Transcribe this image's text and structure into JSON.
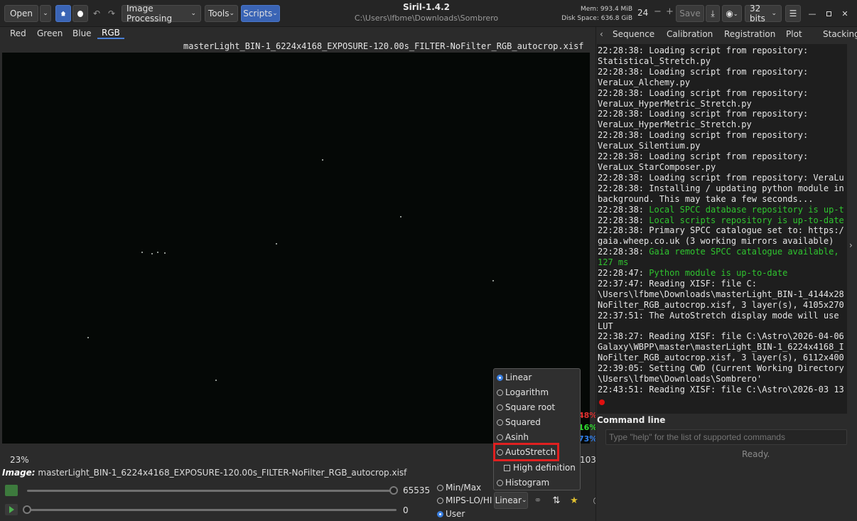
{
  "header": {
    "open_label": "Open",
    "image_processing_label": "Image Processing",
    "tools_label": "Tools",
    "scripts_label": "Scripts",
    "app_title": "Siril-1.4.2",
    "cwd": "C:\\Users\\lfbme\\Downloads\\Sombrero",
    "mem": "Mem: 993.4 MiB",
    "disk": "Disk Space: 636.8 GiB",
    "cpu_count": "24",
    "save_label": "Save",
    "bits_label": "32 bits"
  },
  "channels": [
    "Red",
    "Green",
    "Blue",
    "RGB"
  ],
  "filename_top": "masterLight_BIN-1_6224x4168_EXPOSURE-120.00s_FILTER-NoFilter_RGB_autocrop.xisf",
  "zoom": "23%",
  "pct_red": "48%",
  "pct_green": "16%",
  "pct_blue": "73%",
  "partial_103": "103",
  "image_label": "Image:",
  "image_name": "masterLight_BIN-1_6224x4168_EXPOSURE-120.00s_FILTER-NoFilter_RGB_autocrop.xisf",
  "slider_high": "65535",
  "slider_low": "0",
  "scale_modes": [
    "Min/Max",
    "MIPS-LO/HI",
    "User"
  ],
  "display_mode_button": "Linear",
  "display_menu": {
    "items": [
      "Linear",
      "Logarithm",
      "Square root",
      "Squared",
      "Asinh",
      "AutoStretch"
    ],
    "high_def": "High definition",
    "histogram": "Histogram"
  },
  "right_tabs": [
    "Sequence",
    "Calibration",
    "Registration",
    "Plot",
    "Stacking"
  ],
  "log_lines": [
    {
      "t": "22:28:38: Loading script from repository:",
      "c": ""
    },
    {
      "t": "Statistical_Stretch.py",
      "c": ""
    },
    {
      "t": "22:28:38: Loading script from repository:",
      "c": ""
    },
    {
      "t": "VeraLux_Alchemy.py",
      "c": ""
    },
    {
      "t": "22:28:38: Loading script from repository:",
      "c": ""
    },
    {
      "t": "VeraLux_HyperMetric_Stretch.py",
      "c": ""
    },
    {
      "t": "22:28:38: Loading script from repository:",
      "c": ""
    },
    {
      "t": "VeraLux_HyperMetric_Stretch.py",
      "c": ""
    },
    {
      "t": "22:28:38: Loading script from repository:",
      "c": ""
    },
    {
      "t": "VeraLux_Silentium.py",
      "c": ""
    },
    {
      "t": "22:28:38: Loading script from repository:",
      "c": ""
    },
    {
      "t": "VeraLux_StarComposer.py",
      "c": ""
    },
    {
      "t": "22:28:38: Loading script from repository: VeraLu",
      "c": ""
    },
    {
      "t": "22:28:38: Installing / updating python module in",
      "c": ""
    },
    {
      "t": "background. This may take a few seconds...",
      "c": ""
    },
    {
      "t": "22:28:38: ",
      "c": "",
      "g": "Local SPCC database repository is up-t"
    },
    {
      "t": "22:28:38: ",
      "c": "",
      "g": "Local scripts repository is up-to-date"
    },
    {
      "t": "22:28:38: Primary SPCC catalogue set to: https:/",
      "c": ""
    },
    {
      "t": "gaia.wheep.co.uk (3 working mirrors available)",
      "c": ""
    },
    {
      "t": "22:28:38: ",
      "c": "",
      "g": "Gaia remote SPCC catalogue available,"
    },
    {
      "t": "",
      "c": "",
      "g": "127 ms"
    },
    {
      "t": "22:28:47: ",
      "c": "",
      "g": "Python module is up-to-date"
    },
    {
      "t": "22:37:47: Reading XISF: file C:",
      "c": ""
    },
    {
      "t": "\\Users\\lfbme\\Downloads\\masterLight_BIN-1_4144x28",
      "c": ""
    },
    {
      "t": "NoFilter_RGB_autocrop.xisf, 3 layer(s), 4105x270",
      "c": ""
    },
    {
      "t": "22:37:51: The AutoStretch display mode will use",
      "c": ""
    },
    {
      "t": "LUT",
      "c": ""
    },
    {
      "t": "22:38:27: Reading XISF: file C:\\Astro\\2026-04-06",
      "c": ""
    },
    {
      "t": "Galaxy\\WBPP\\master\\masterLight_BIN-1_6224x4168_I",
      "c": ""
    },
    {
      "t": "NoFilter_RGB_autocrop.xisf, 3 layer(s), 6112x400",
      "c": ""
    },
    {
      "t": "22:39:05: Setting CWD (Current Working Directory",
      "c": ""
    },
    {
      "t": "\\Users\\lfbme\\Downloads\\Sombrero'",
      "c": ""
    },
    {
      "t": "22:43:51: Reading XISF: file C:\\Astro\\2026-03 13",
      "c": ""
    }
  ],
  "command_line_label": "Command line",
  "command_placeholder": "Type \"help\" for the list of supported commands",
  "status": "Ready."
}
